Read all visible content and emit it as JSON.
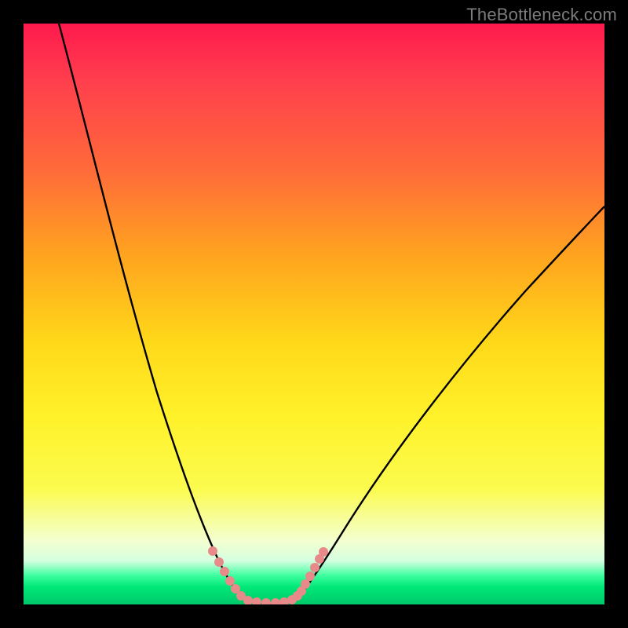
{
  "watermark": "TheBottleneck.com",
  "chart_data": {
    "type": "line",
    "title": "",
    "xlabel": "",
    "ylabel": "",
    "xlim": [
      0,
      100
    ],
    "ylim": [
      0,
      100
    ],
    "background_gradient": {
      "direction": "vertical",
      "stops": [
        {
          "pos": 0,
          "color": "#ff1a4d",
          "meaning": "high-bottleneck"
        },
        {
          "pos": 50,
          "color": "#ffd919",
          "meaning": "moderate"
        },
        {
          "pos": 100,
          "color": "#00c86a",
          "meaning": "optimal"
        }
      ]
    },
    "series": [
      {
        "name": "bottleneck-curve",
        "color": "#000000",
        "x": [
          0,
          5,
          10,
          15,
          20,
          25,
          28,
          30,
          32,
          34,
          36,
          38,
          40,
          42,
          44,
          46,
          50,
          55,
          60,
          65,
          70,
          75,
          80,
          85,
          90,
          95,
          100
        ],
        "y": [
          100,
          89,
          77,
          64,
          50,
          34,
          23,
          15,
          8,
          3,
          1,
          0,
          0,
          0,
          0,
          1,
          6,
          14,
          23,
          31,
          38,
          44,
          50,
          55,
          60,
          64,
          68
        ]
      },
      {
        "name": "optimal-zone-marker",
        "color": "#e98a8a",
        "x": [
          31,
          32,
          33,
          34,
          35,
          36,
          38,
          40,
          42,
          44,
          45,
          46,
          47,
          48
        ],
        "y": [
          12,
          8,
          5,
          3,
          2,
          1,
          0,
          0,
          0,
          0,
          1,
          2,
          5,
          9
        ]
      }
    ]
  }
}
